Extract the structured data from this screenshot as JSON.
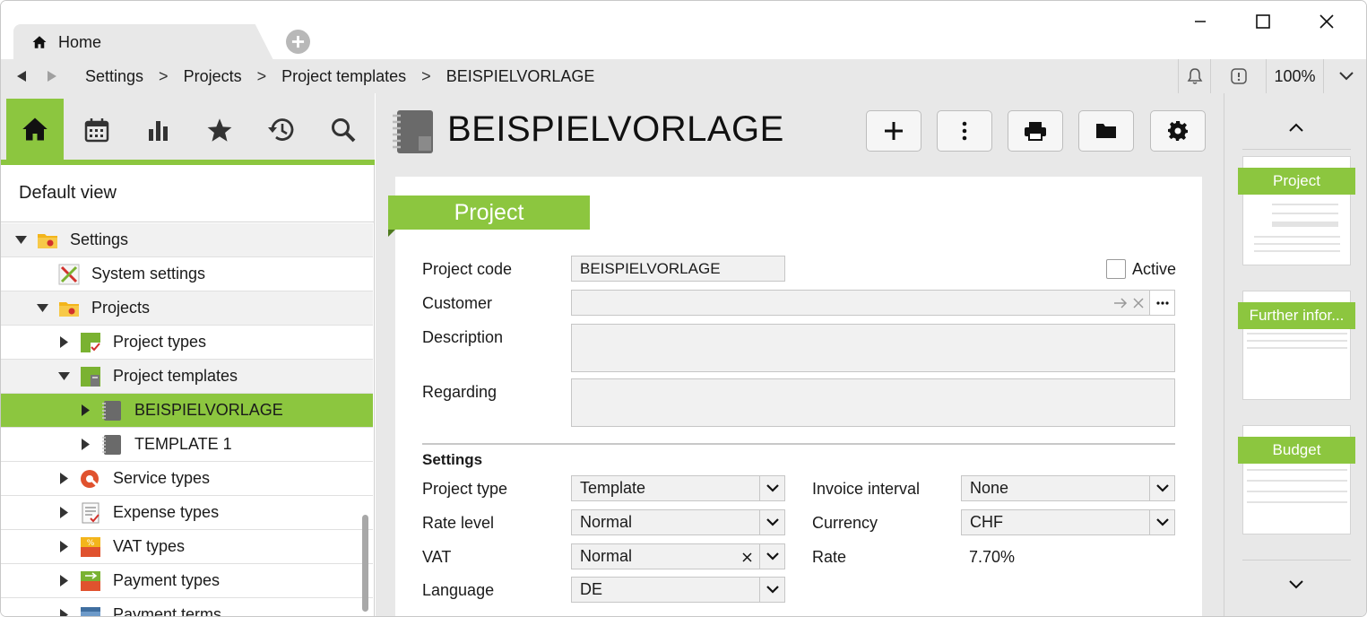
{
  "window": {
    "tab_label": "Home",
    "new_tab_icon": "plus-circle-icon",
    "controls": [
      "minimize-icon",
      "maximize-icon",
      "close-icon"
    ]
  },
  "navbar": {
    "breadcrumbs": [
      "Settings",
      "Projects",
      "Project templates",
      "BEISPIELVORLAGE"
    ],
    "separator": ">",
    "zoom": "100%"
  },
  "sidebar": {
    "toolbar_icons": [
      "home-icon",
      "calendar-icon",
      "chart-icon",
      "star-icon",
      "history-icon",
      "search-icon"
    ],
    "default_view": "Default view",
    "tree": [
      {
        "label": "Settings",
        "level": 0,
        "expanded": true,
        "icon": "folder-settings-icon"
      },
      {
        "label": "System settings",
        "level": 1,
        "icon": "tools-icon"
      },
      {
        "label": "Projects",
        "level": 1,
        "expanded": true,
        "icon": "folder-projects-icon"
      },
      {
        "label": "Project types",
        "level": 2,
        "icon": "project-types-icon"
      },
      {
        "label": "Project templates",
        "level": 2,
        "expanded": true,
        "icon": "project-templates-icon"
      },
      {
        "label": "BEISPIELVORLAGE",
        "level": 3,
        "selected": true,
        "icon": "notebook-icon"
      },
      {
        "label": "TEMPLATE 1",
        "level": 3,
        "icon": "notebook-icon"
      },
      {
        "label": "Service types",
        "level": 2,
        "icon": "service-types-icon"
      },
      {
        "label": "Expense types",
        "level": 2,
        "icon": "expense-types-icon"
      },
      {
        "label": "VAT types",
        "level": 2,
        "icon": "vat-types-icon"
      },
      {
        "label": "Payment types",
        "level": 2,
        "icon": "payment-types-icon"
      },
      {
        "label": "Payment terms",
        "level": 2,
        "icon": "payment-terms-icon"
      }
    ]
  },
  "main": {
    "title": "BEISPIELVORLAGE",
    "toolbar_icons": [
      "add-icon",
      "more-icon",
      "print-icon",
      "folder-icon",
      "settings-gear-icon"
    ],
    "section_tab": "Project",
    "fields": {
      "project_code_label": "Project code",
      "project_code_value": "BEISPIELVORLAGE",
      "active_label": "Active",
      "active_checked": false,
      "customer_label": "Customer",
      "customer_value": "",
      "description_label": "Description",
      "regarding_label": "Regarding"
    },
    "settings": {
      "heading": "Settings",
      "project_type_label": "Project type",
      "project_type_value": "Template",
      "rate_level_label": "Rate level",
      "rate_level_value": "Normal",
      "vat_label": "VAT",
      "vat_value": "Normal",
      "language_label": "Language",
      "language_value": "DE",
      "invoice_interval_label": "Invoice interval",
      "invoice_interval_value": "None",
      "currency_label": "Currency",
      "currency_value": "CHF",
      "rate_label": "Rate",
      "rate_value": "7.70%"
    }
  },
  "right_panel": {
    "thumbnails": [
      "Project",
      "Further infor...",
      "Budget"
    ]
  },
  "colors": {
    "accent": "#8cc63f",
    "panel_bg": "#e8e8e8"
  }
}
